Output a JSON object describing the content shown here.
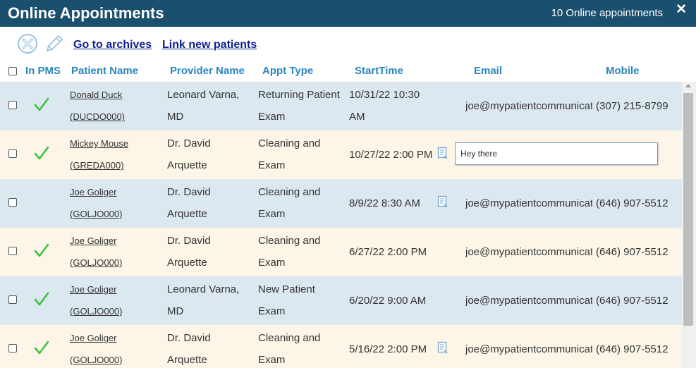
{
  "window": {
    "title": "Online Appointments",
    "count_text": "10 Online appointments",
    "close_label": "✕"
  },
  "toolbar": {
    "cancel_icon": "cancel-circle-icon",
    "edit_icon": "pencil-icon",
    "archives_label": "Go to archives",
    "link_patients_label": "Link new patients"
  },
  "columns": {
    "in_pms": "In PMS",
    "patient_name": "Patient Name",
    "provider_name": "Provider Name",
    "appt_type": "Appt Type",
    "start_time": "StartTime",
    "email": "Email",
    "mobile": "Mobile"
  },
  "colors": {
    "title_bar": "#1a4f6e",
    "header_text": "#2a86bc",
    "link": "#0c1f8f",
    "check": "#3cc13c",
    "row_blue": "#dce8f0",
    "row_cream": "#fdf6e8"
  },
  "rows": [
    {
      "in_pms": true,
      "patient_line1": "Donald Duck",
      "patient_line2": "(DUCDO000)",
      "provider_line1": "Leonard Varna,",
      "provider_line2": "MD",
      "appt_line1": "Returning Patient",
      "appt_line2": "Exam",
      "start_line1": "10/31/22 10:30",
      "start_line2": "AM",
      "has_note": false,
      "email": "joe@mypatientcommunicato",
      "mobile": "(307) 215-8799"
    },
    {
      "in_pms": true,
      "patient_line1": "Mickey Mouse",
      "patient_line2": "(GREDA000)",
      "provider_line1": "Dr. David",
      "provider_line2": "Arquette",
      "appt_line1": "Cleaning and",
      "appt_line2": "Exam",
      "start_time": "10/27/22 2:00 PM",
      "has_note": true,
      "note_text": "Hey there"
    },
    {
      "in_pms": false,
      "patient_line1": "Joe Goliger",
      "patient_line2": "(GOLJO000)",
      "provider_line1": "Dr. David",
      "provider_line2": "Arquette",
      "appt_line1": "Cleaning and",
      "appt_line2": "Exam",
      "start_time": "8/9/22 8:30 AM",
      "has_note": true,
      "email": "joe@mypatientcommunicato",
      "mobile": "(646) 907-5512"
    },
    {
      "in_pms": true,
      "patient_line1": "Joe Goliger",
      "patient_line2": "(GOLJO000)",
      "provider_line1": "Dr. David",
      "provider_line2": "Arquette",
      "appt_line1": "Cleaning and",
      "appt_line2": "Exam",
      "start_time": "6/27/22 2:00 PM",
      "has_note": false,
      "email": "joe@mypatientcommunicato",
      "mobile": "(646) 907-5512"
    },
    {
      "in_pms": true,
      "patient_line1": "Joe Goliger",
      "patient_line2": "(GOLJO000)",
      "provider_line1": "Leonard Varna,",
      "provider_line2": "MD",
      "appt_line1": "New Patient",
      "appt_line2": "Exam",
      "start_time": "6/20/22 9:00 AM",
      "has_note": false,
      "email": "joe@mypatientcommunicato",
      "mobile": "(646) 907-5512"
    },
    {
      "in_pms": true,
      "patient_line1": "Joe Goliger",
      "patient_line2": "(GOLJO000)",
      "provider_line1": "Dr. David",
      "provider_line2": "Arquette",
      "appt_line1": "Cleaning and",
      "appt_line2": "Exam",
      "start_time": "5/16/22 2:00 PM",
      "has_note": true,
      "email": "joe@mypatientcommunicato",
      "mobile": "(646) 907-5512"
    }
  ]
}
